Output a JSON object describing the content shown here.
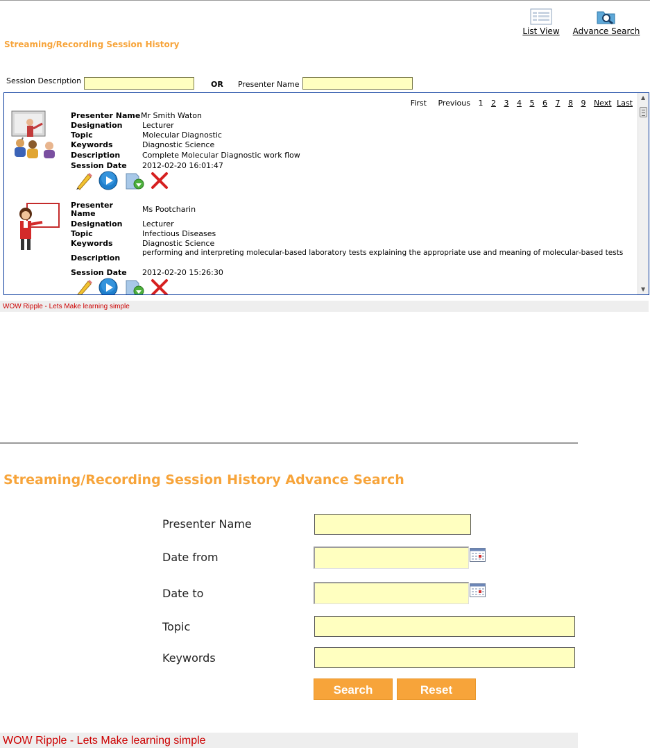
{
  "top": {
    "view_buttons": {
      "list_view": "List View",
      "advance_search": "Advance Search"
    },
    "title": "Streaming/Recording Session History",
    "filter": {
      "session_description_label": "Session Description",
      "or_label": "OR",
      "presenter_name_label": "Presenter Name",
      "session_description_value": "",
      "presenter_name_value": ""
    },
    "pager": {
      "first": "First",
      "previous": "Previous",
      "pages": [
        "1",
        "2",
        "3",
        "4",
        "5",
        "6",
        "7",
        "8",
        "9"
      ],
      "next": "Next",
      "last": "Last"
    },
    "labels": {
      "presenter_name": "Presenter Name",
      "presenter": "Presenter",
      "name": "Name",
      "designation": "Designation",
      "topic": "Topic",
      "keywords": "Keywords",
      "description": "Description",
      "session_date": "Session Date"
    },
    "records": [
      {
        "presenter_name": "Mr Smith Waton",
        "designation": "Lecturer",
        "topic": "Molecular Diagnostic",
        "keywords": "Diagnostic Science",
        "description": "Complete Molecular Diagnostic work flow",
        "session_date": "2012-02-20 16:01:47",
        "image_icon": "lecture-classroom-icon"
      },
      {
        "presenter_name": "Ms Pootcharin",
        "designation": "Lecturer",
        "topic": "Infectious Diseases",
        "keywords": "Diagnostic Science",
        "description": "performing and interpreting molecular-based laboratory tests explaining the appropriate use and meaning of molecular-based tests",
        "session_date": "2012-02-20 15:26:30",
        "image_icon": "presenter-woman-icon"
      }
    ],
    "action_icons": [
      "pencil-icon",
      "play-icon",
      "download-icon",
      "delete-x-icon"
    ],
    "footer": "WOW Ripple - Lets Make learning simple"
  },
  "bottom": {
    "title": "Streaming/Recording Session History Advance Search",
    "fields": {
      "presenter_name": "Presenter Name",
      "date_from": "Date from",
      "date_to": "Date to",
      "topic": "Topic",
      "keywords": "Keywords"
    },
    "values": {
      "presenter_name": "",
      "date_from": "",
      "date_to": "",
      "topic": "",
      "keywords": ""
    },
    "buttons": {
      "search": "Search",
      "reset": "Reset"
    },
    "footer": "WOW Ripple - Lets Make learning simple"
  },
  "colors": {
    "accent_orange": "#f7a43a",
    "input_yellow": "#ffffc0",
    "footer_red": "#cc0000",
    "panel_border": "#003399"
  }
}
